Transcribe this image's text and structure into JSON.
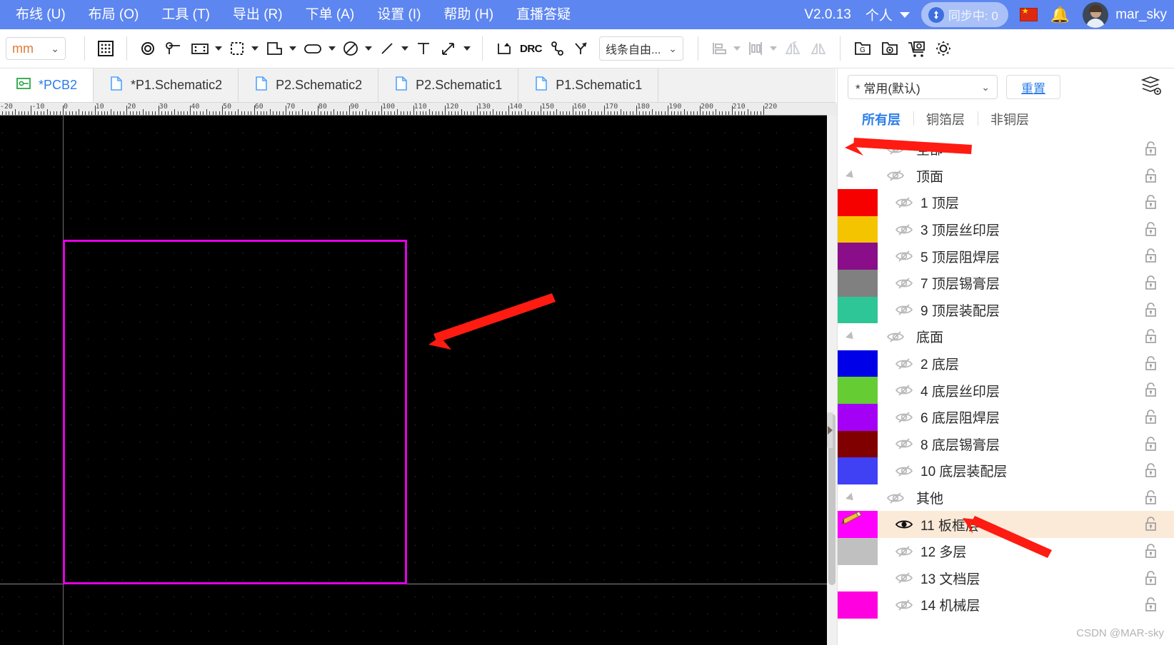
{
  "menu": {
    "items": [
      {
        "label": "布线 (U)",
        "name": "menu-routing"
      },
      {
        "label": "布局 (O)",
        "name": "menu-layout"
      },
      {
        "label": "工具 (T)",
        "name": "menu-tools"
      },
      {
        "label": "导出 (R)",
        "name": "menu-export"
      },
      {
        "label": "下单 (A)",
        "name": "menu-order"
      },
      {
        "label": "设置 (I)",
        "name": "menu-settings"
      },
      {
        "label": "帮助 (H)",
        "name": "menu-help"
      },
      {
        "label": "直播答疑",
        "name": "menu-live-qa"
      }
    ],
    "version": "V2.0.13",
    "account_type": "个人",
    "sync_status": "同步中: 0",
    "username": "mar_sky"
  },
  "toolbar": {
    "unit": "mm",
    "line_mode": "线条自由...",
    "drc_label": "DRC"
  },
  "tabs": [
    {
      "label": "*PCB2",
      "icon": "pcb-icon",
      "active": true
    },
    {
      "label": "*P1.Schematic2",
      "icon": "doc-icon",
      "active": false
    },
    {
      "label": "P2.Schematic2",
      "icon": "doc-icon",
      "active": false
    },
    {
      "label": "P2.Schematic1",
      "icon": "doc-icon",
      "active": false
    },
    {
      "label": "P1.Schematic1",
      "icon": "doc-icon",
      "active": false
    }
  ],
  "ruler": {
    "labels": [
      "-20",
      "-10",
      "0",
      "10",
      "20",
      "30",
      "40",
      "50",
      "60",
      "70",
      "80",
      "90",
      "100",
      "110",
      "120",
      "130",
      "140",
      "150",
      "160",
      "170",
      "180",
      "190",
      "200",
      "210",
      "220"
    ],
    "start": -20,
    "end": 220,
    "step": 10
  },
  "canvas": {
    "background": "#000000",
    "board_outline_color": "#e400e4",
    "grid_dot_color": "#3c3c3c",
    "axis_color": "#7f7f7f"
  },
  "right_panel": {
    "preset": "* 常用(默认)",
    "reset_label": "重置",
    "tabs": [
      {
        "label": "所有层",
        "active": true
      },
      {
        "label": "铜箔层",
        "active": false
      },
      {
        "label": "非铜层",
        "active": false
      }
    ],
    "layers": [
      {
        "label": "全部",
        "color": null,
        "kind": "all",
        "visible": false,
        "group": false,
        "selected": false
      },
      {
        "label": "顶面",
        "color": null,
        "kind": "group",
        "visible": false,
        "group": true,
        "selected": false
      },
      {
        "label": "1 顶层",
        "color": "#f60000",
        "kind": "layer",
        "visible": false,
        "group": false,
        "selected": false
      },
      {
        "label": "3 顶层丝印层",
        "color": "#f5c400",
        "kind": "layer",
        "visible": false,
        "group": false,
        "selected": false
      },
      {
        "label": "5 顶层阻焊层",
        "color": "#8a0d8a",
        "kind": "layer",
        "visible": false,
        "group": false,
        "selected": false
      },
      {
        "label": "7 顶层锡膏层",
        "color": "#808080",
        "kind": "layer",
        "visible": false,
        "group": false,
        "selected": false
      },
      {
        "label": "9 顶层装配层",
        "color": "#2ec696",
        "kind": "layer",
        "visible": false,
        "group": false,
        "selected": false
      },
      {
        "label": "底面",
        "color": null,
        "kind": "group",
        "visible": false,
        "group": true,
        "selected": false
      },
      {
        "label": "2 底层",
        "color": "#0000e8",
        "kind": "layer",
        "visible": false,
        "group": false,
        "selected": false
      },
      {
        "label": "4 底层丝印层",
        "color": "#66cc33",
        "kind": "layer",
        "visible": false,
        "group": false,
        "selected": false
      },
      {
        "label": "6 底层阻焊层",
        "color": "#a300f5",
        "kind": "layer",
        "visible": false,
        "group": false,
        "selected": false
      },
      {
        "label": "8 底层锡膏层",
        "color": "#800000",
        "kind": "layer",
        "visible": false,
        "group": false,
        "selected": false
      },
      {
        "label": "10 底层装配层",
        "color": "#4040f5",
        "kind": "layer",
        "visible": false,
        "group": false,
        "selected": false
      },
      {
        "label": "其他",
        "color": null,
        "kind": "group",
        "visible": false,
        "group": true,
        "selected": false
      },
      {
        "label": "11 板框层",
        "color": "#ff00ff",
        "kind": "layer",
        "visible": true,
        "group": false,
        "selected": true
      },
      {
        "label": "12 多层",
        "color": "#c0c0c0",
        "kind": "layer",
        "visible": false,
        "group": false,
        "selected": false
      },
      {
        "label": "13 文档层",
        "color": "#ffffff",
        "kind": "layer",
        "visible": false,
        "group": false,
        "selected": false
      },
      {
        "label": "14 机械层",
        "color": "#ff00e0",
        "kind": "layer",
        "visible": false,
        "group": false,
        "selected": false
      }
    ]
  },
  "watermark": "CSDN @MAR-sky"
}
